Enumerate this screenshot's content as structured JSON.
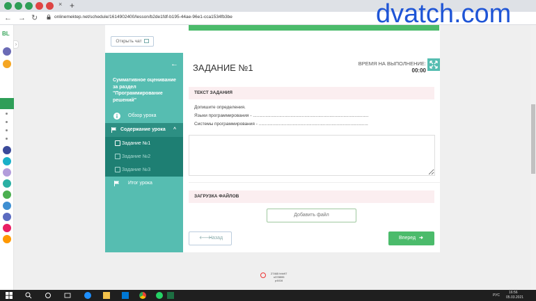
{
  "browser": {
    "url": "onlinemektep.net/schedule/1614902400/lesson/b2de1fdf-b195-44ae-96e1-cca1534fb3be",
    "new_tab": "+",
    "tab_close": "×"
  },
  "watermark": "dvatch.com",
  "rail": {
    "logo": "BL"
  },
  "header": {
    "chat_button": "Открыть чат"
  },
  "sidebar": {
    "back_icon": "←",
    "title": "Суммативное оценивание за раздел \"Программирование решений\"",
    "items": [
      {
        "label": "Обзор урока",
        "icon": "info-icon"
      },
      {
        "label": "Содержание урока",
        "icon": "flag-icon",
        "chevron": "^"
      },
      {
        "label": "Итог урока",
        "icon": "flag-icon"
      }
    ],
    "subitems": [
      {
        "label": "Задание №1"
      },
      {
        "label": "Задание №2"
      },
      {
        "label": "Задание №3"
      }
    ]
  },
  "task": {
    "title": "ЗАДАНИЕ №1",
    "time_label": "ВРЕМЯ НА ВЫПОЛНЕНИЕ:",
    "time_value": "00:00",
    "text_header": "ТЕКСТ ЗАДАНИЯ",
    "lines": [
      "Допишите определения.",
      "Языки программирования - ............................................................................................",
      "Системы программирования - ......................................................................................."
    ],
    "upload_header": "ЗАГРУЗКА ФАЙЛОВ",
    "add_file": "Добавить файл",
    "back_arrow": "🡐",
    "back": "Назад",
    "next": "Вперед",
    "next_arrow": "➜"
  },
  "footer": {
    "line1": "27465 hhh97",
    "line2": "n378595",
    "line3": "p4416"
  },
  "taskbar": {
    "lang": "РУС",
    "time": "16:56",
    "date": "05.03.2021"
  },
  "colors": {
    "teal": "#56bdb1",
    "teal_dark": "#1e7f73",
    "green": "#4bbb6b",
    "pink": "#fbeef0"
  }
}
